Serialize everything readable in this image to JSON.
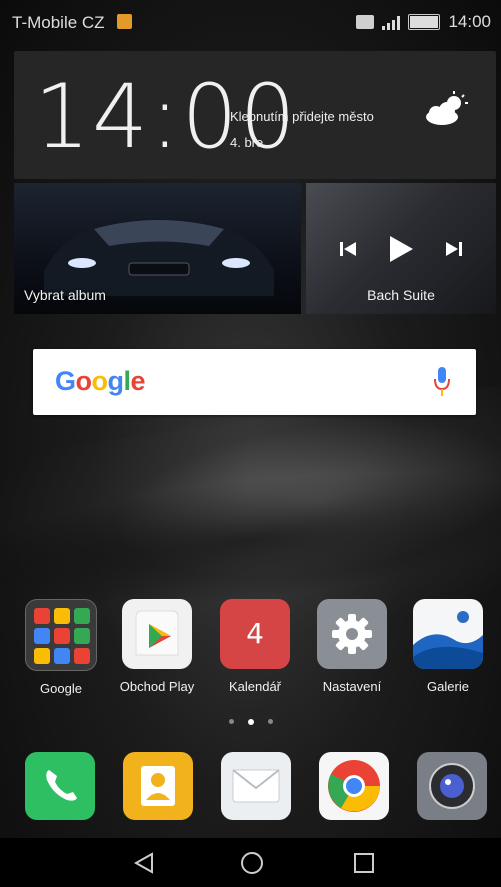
{
  "status_bar": {
    "carrier": "T-Mobile CZ",
    "time": "14:00"
  },
  "clock_widget": {
    "time": "14:00",
    "weather_prompt": "Klepnutím přidejte město",
    "date": "4. bře"
  },
  "music_widget": {
    "album_label": "Vybrat album",
    "track_label": "Bach Suite"
  },
  "search": {
    "logo": "Google"
  },
  "apps": [
    {
      "label": "Google"
    },
    {
      "label": "Obchod Play"
    },
    {
      "label": "Kalendář",
      "badge": "4"
    },
    {
      "label": "Nastavení"
    },
    {
      "label": "Galerie"
    }
  ],
  "page_indicator": {
    "pages": 3,
    "active": 2
  },
  "dock": [
    {
      "icon": "phone-icon"
    },
    {
      "icon": "contacts-icon"
    },
    {
      "icon": "messages-icon"
    },
    {
      "icon": "chrome-icon"
    },
    {
      "icon": "camera-icon"
    }
  ],
  "colors": {
    "google_blue": "#4285F4",
    "google_red": "#EA4335",
    "google_yellow": "#FBBC05",
    "google_green": "#34A853"
  }
}
